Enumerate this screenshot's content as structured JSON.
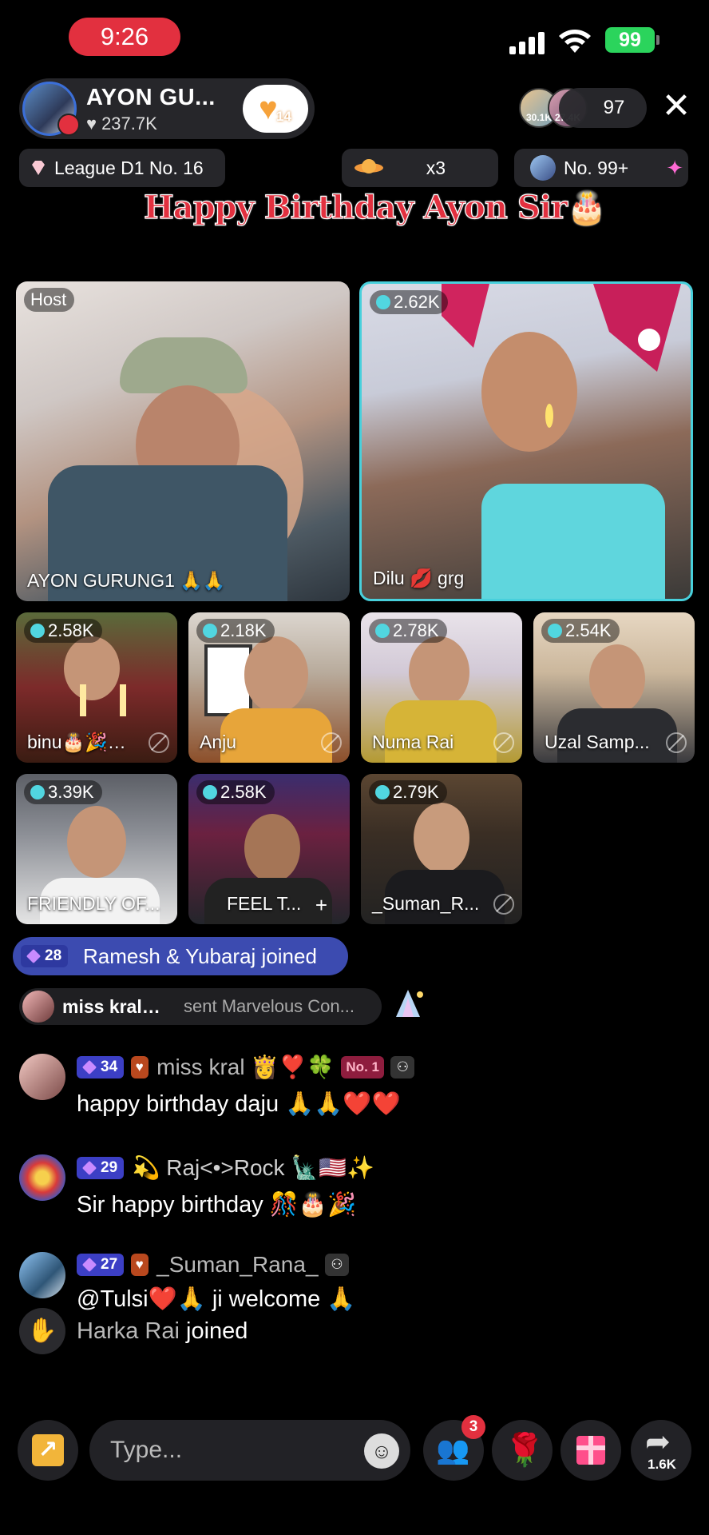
{
  "status_bar": {
    "time": "9:26",
    "battery": "99"
  },
  "header": {
    "host_name": "AYON GU...",
    "host_likes": "237.7K",
    "follow_count": "14",
    "top_viewers": [
      {
        "score": "30.1K"
      },
      {
        "score": "27.4K"
      }
    ],
    "viewer_count": "97",
    "close_icon": "close-icon"
  },
  "info_pills": {
    "league": "League D1 No. 16",
    "team_multiplier": "x3",
    "rank": "No. 99+"
  },
  "banner_title": "Happy Birthday Ayon Sir🎂",
  "tiles": {
    "host": {
      "badge": "Host",
      "name": "AYON GURUNG1 🙏🙏"
    },
    "dilu": {
      "score": "2.62K",
      "name": "Dilu 💋 grg"
    },
    "binu": {
      "score": "2.58K",
      "name": "binu🎂🎉…"
    },
    "anju": {
      "score": "2.18K",
      "name": "Anju"
    },
    "numa": {
      "score": "2.78K",
      "name": "Numa Rai"
    },
    "uzal": {
      "score": "2.54K",
      "name": "Uzal Samp..."
    },
    "friendly": {
      "score": "3.39K",
      "name": "FRIENDLY OF..."
    },
    "feel": {
      "score": "2.58K",
      "name": "FEEL T..."
    },
    "suman": {
      "score": "2.79K",
      "name": "_Suman_R..."
    }
  },
  "join_banner": {
    "level": "28",
    "text": "Ramesh & Yubaraj joined"
  },
  "gift_banner": {
    "name": "miss kral…",
    "text": "sent Marvelous Con..."
  },
  "messages": [
    {
      "level": "34",
      "badge_num": "",
      "username": "miss kral 👸❣️🍀",
      "tag": "No. 1",
      "text": "happy birthday daju 🙏🙏❤️❤️"
    },
    {
      "level": "29",
      "username": "💫 Raj<•>Rock 🗽🇺🇸✨",
      "text": "Sir happy birthday 🎊🎂🎉"
    },
    {
      "level": "27",
      "username": "_Suman_Rana_",
      "text": "@Tulsi❤️🙏 ji welcome 🙏"
    }
  ],
  "system_join": {
    "name": "Harka Rai",
    "text": "joined"
  },
  "bottom_bar": {
    "placeholder": "Type...",
    "guest_requests": "3",
    "share_count": "1.6K"
  },
  "colors": {
    "accent": "#e2303f",
    "battery": "#2bd45c",
    "level_badge": "#3c3fc5",
    "tile_highlight": "#48d0dc"
  }
}
